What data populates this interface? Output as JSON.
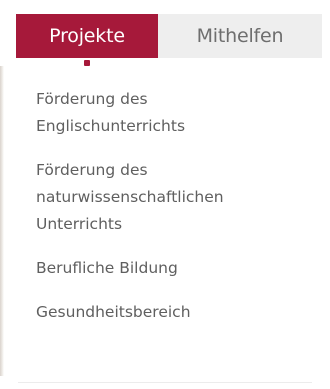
{
  "colors": {
    "accent": "#a6193a",
    "inactive_tab_bg": "#eeeeee",
    "text": "#5f5f5f"
  },
  "tabs": {
    "active_label": "Projekte",
    "inactive_label": "Mithelfen"
  },
  "menu": {
    "items": [
      {
        "label": "Förderung des\nEnglischunterrichts"
      },
      {
        "label": "Förderung des\nnaturwissenschaftlichen\nUnterrichts"
      },
      {
        "label": "Berufliche Bildung"
      },
      {
        "label": "Gesundheitsbereich"
      }
    ]
  }
}
